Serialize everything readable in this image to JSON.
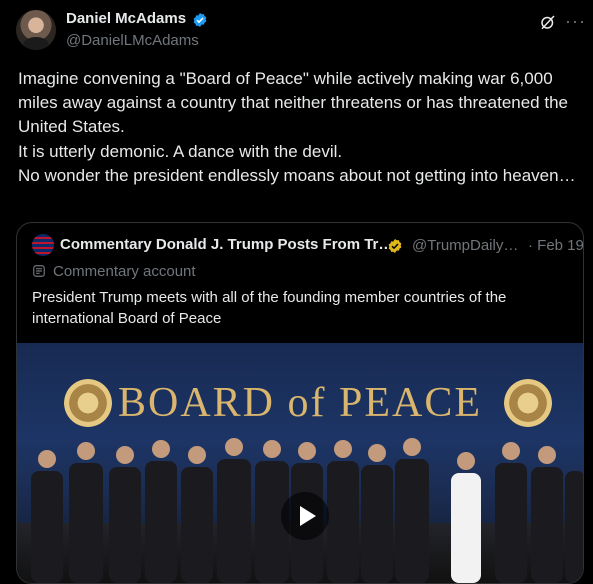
{
  "post": {
    "author_name": "Daniel McAdams",
    "author_handle": "@DanielLMcAdams",
    "paragraphs": [
      "Imagine convening a \"Board of Peace\" while actively making war 6,000 miles away against a country that neither threatens or has threatened the United States.",
      "It is utterly demonic. A dance with the devil.",
      "No wonder the president endlessly moans about not getting into heaven…"
    ],
    "more_label": "···"
  },
  "quote": {
    "author_name": "Commentary Donald J. Trump Posts From Tr…",
    "author_handle": "@TrumpDaily…",
    "separator_date": "· Feb 19",
    "badge": "Commentary account",
    "text": "President Trump meets with all of the founding member countries of the international Board of Peace",
    "media_title": "BOARD of PEACE"
  },
  "colors": {
    "background": "#000000",
    "text": "#e7e9ea",
    "muted": "#71767b",
    "verified_blue": "#1d9bf0",
    "verified_gold": "#e2b719",
    "border": "#2f3336"
  }
}
